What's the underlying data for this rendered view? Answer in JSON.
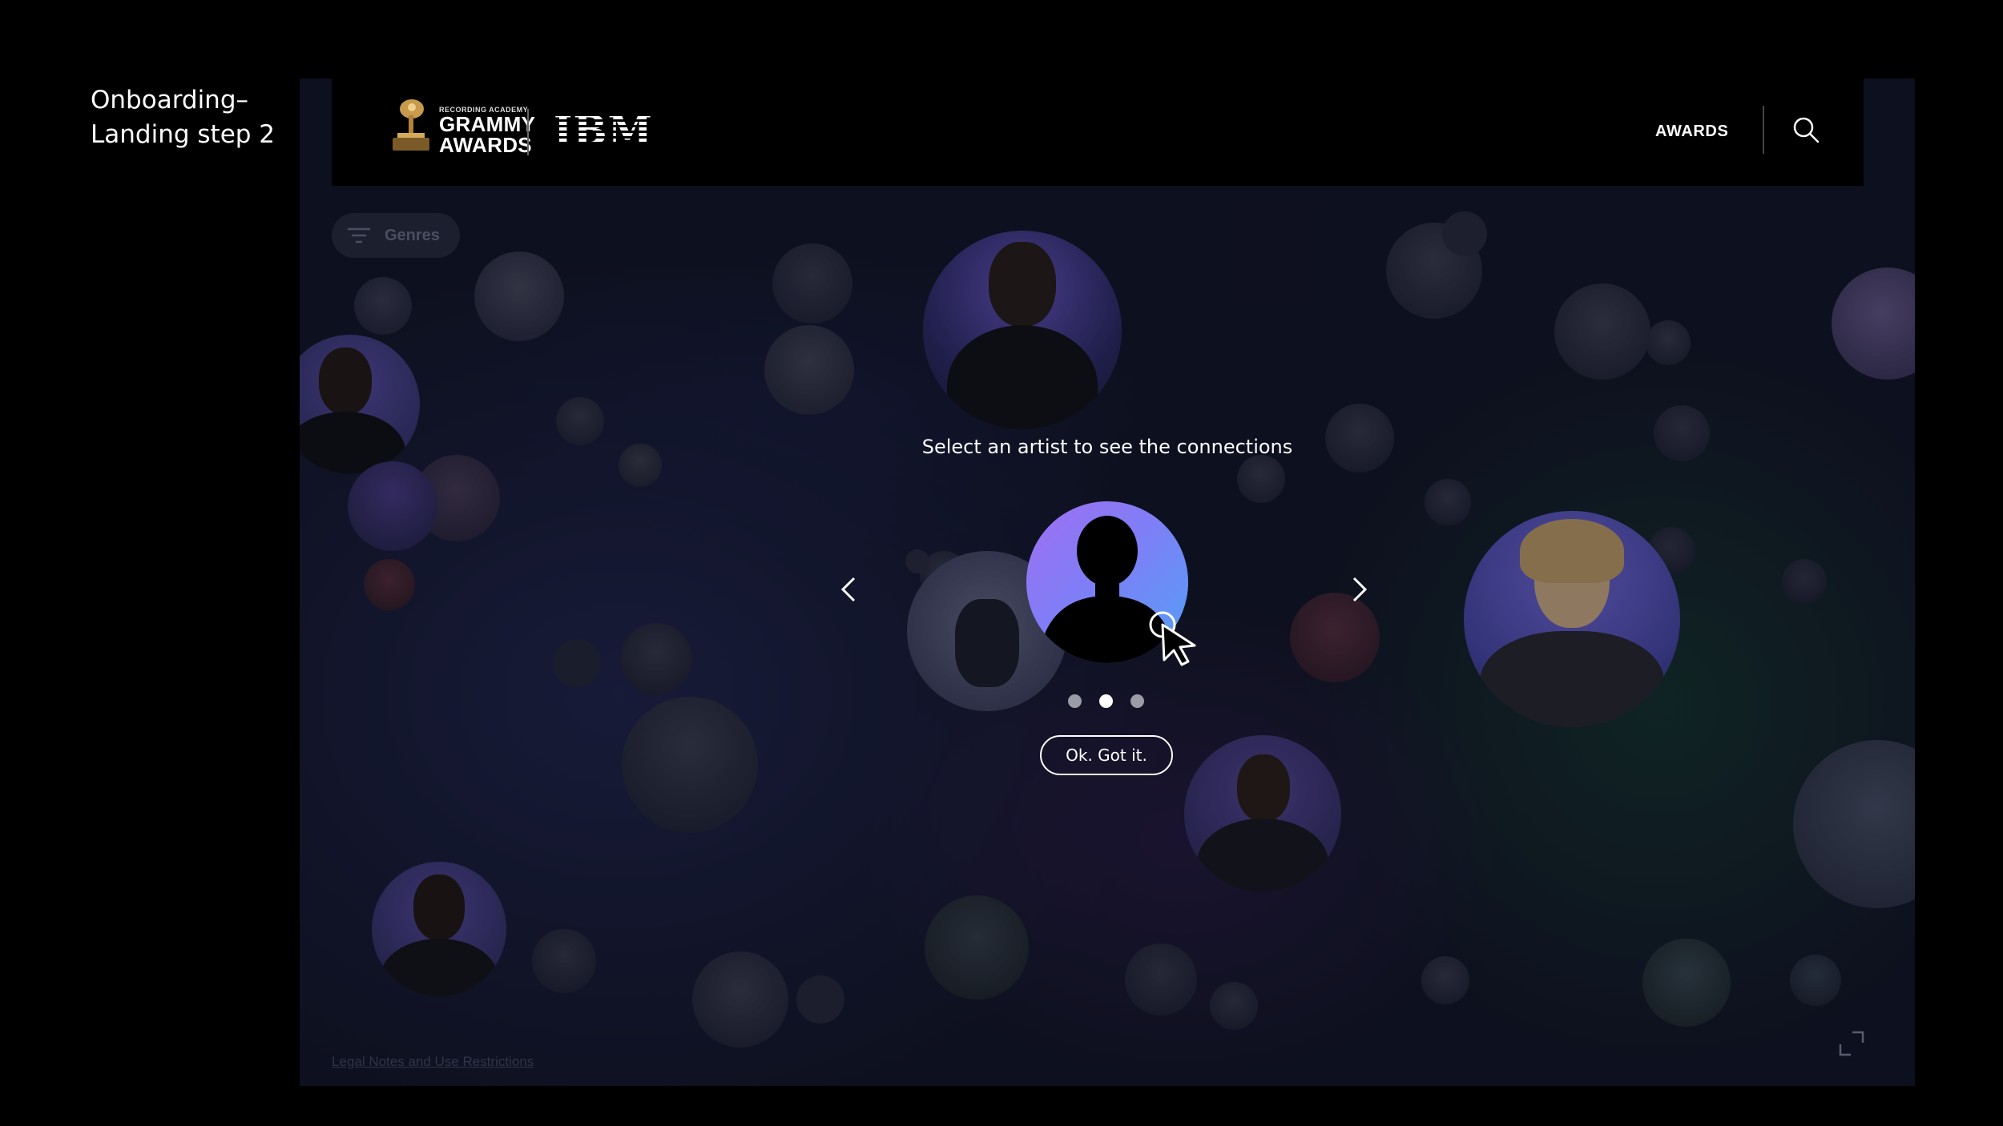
{
  "slide": {
    "title_line1": "Onboarding–",
    "title_line2": "Landing step 2"
  },
  "header": {
    "brand_small": "RECORDING ACADEMY",
    "brand_line1": "GRAMMY",
    "brand_line2": "AWARDS",
    "partner_logo": "IBM",
    "nav_awards": "AWARDS",
    "search_icon": "search-icon"
  },
  "filters": {
    "genres_label": "Genres",
    "icon": "filter-icon"
  },
  "onboarding": {
    "prompt": "Select an artist to see the connections",
    "step_total": 3,
    "step_current": 2,
    "ok_button": "Ok. Got it.",
    "prev_icon": "chevron-left-icon",
    "next_icon": "chevron-right-icon",
    "avatar_icon": "user-silhouette-icon",
    "cursor_icon": "pointer-click-icon"
  },
  "footer": {
    "legal_link": "Legal Notes and Use Restrictions",
    "expand_icon": "expand-icon"
  },
  "colors": {
    "background": "#121526",
    "header": "#000000",
    "avatar_gradient_start": "#a06ff2",
    "avatar_gradient_end": "#52a0f6",
    "dot_active": "#ffffff",
    "dot_inactive": "#9a9ca6"
  }
}
